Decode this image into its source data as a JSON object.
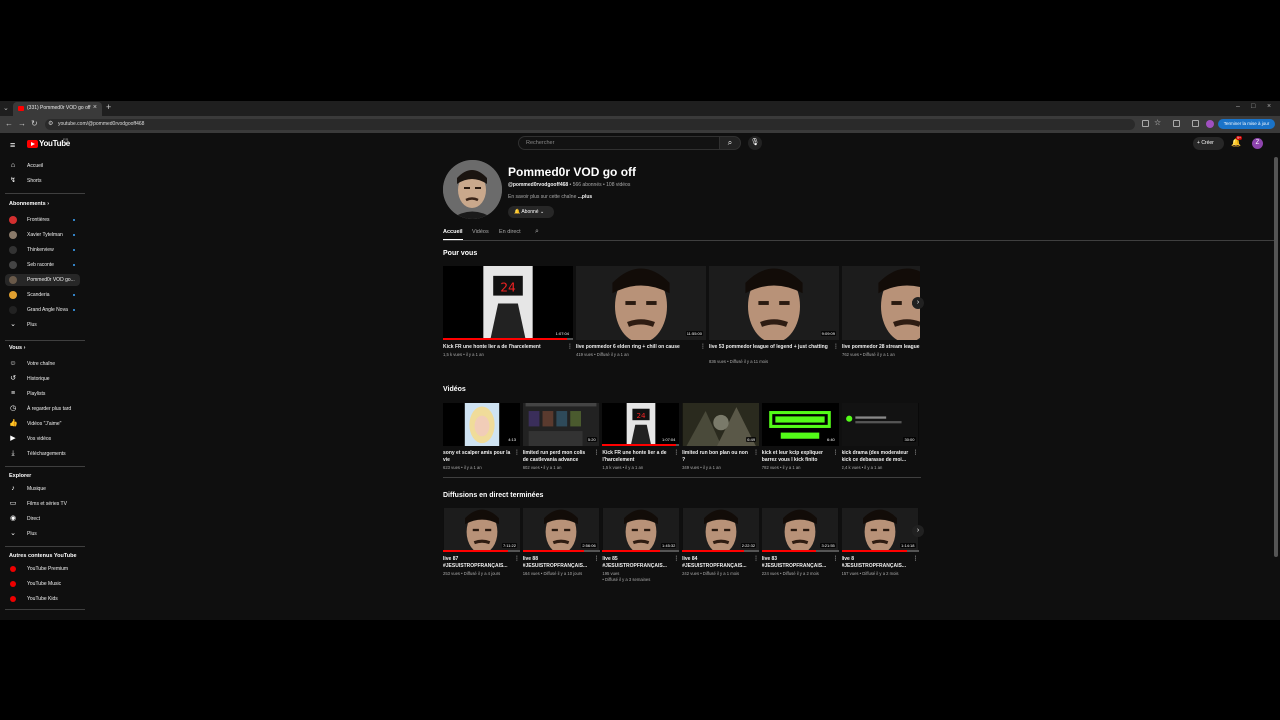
{
  "browser": {
    "tab_title": "(331) Pommed0r VOD go off",
    "url": "youtube.com/@pommed0rvodgooff468",
    "update_label": "Terminer la mise à jour"
  },
  "header": {
    "logo_text": "YouTube",
    "region": "FR",
    "search_placeholder": "Rechercher",
    "create_label": "Créer",
    "notif_count": "9+",
    "avatar_letter": "Z"
  },
  "sidebar": {
    "main": [
      {
        "label": "Accueil",
        "icon": "home-icon",
        "glyph": "⌂"
      },
      {
        "label": "Shorts",
        "icon": "shorts-icon",
        "glyph": "↯"
      }
    ],
    "subscriptions_title": "Abonnements",
    "subscriptions": [
      {
        "label": "Frontières",
        "color": "#d32f2f",
        "active": false
      },
      {
        "label": "Xavier Tytelman",
        "color": "#8a7a6a",
        "active": false
      },
      {
        "label": "Thinkerview",
        "color": "#333333",
        "active": false
      },
      {
        "label": "Seb raconte",
        "color": "#444444",
        "active": false
      },
      {
        "label": "Pommed0r VOD go...",
        "color": "#6a5a4a",
        "active": true
      },
      {
        "label": "Scanderia",
        "color": "#e0a030",
        "active": false
      },
      {
        "label": "Grand Angle Nova",
        "color": "#222222",
        "active": false
      },
      {
        "label": "Plus",
        "color": "",
        "active": false
      }
    ],
    "you_title": "Vous",
    "you": [
      {
        "label": "Votre chaîne",
        "icon": "channel-icon",
        "glyph": "☺"
      },
      {
        "label": "Historique",
        "icon": "history-icon",
        "glyph": "↺"
      },
      {
        "label": "Playlists",
        "icon": "playlist-icon",
        "glyph": "≡"
      },
      {
        "label": "À regarder plus tard",
        "icon": "clock-icon",
        "glyph": "◷"
      },
      {
        "label": "Vidéos \"J'aime\"",
        "icon": "like-icon",
        "glyph": "👍"
      },
      {
        "label": "Vos vidéos",
        "icon": "video-icon",
        "glyph": "▶"
      },
      {
        "label": "Téléchargements",
        "icon": "download-icon",
        "glyph": "⤓"
      }
    ],
    "explore_title": "Explorer",
    "explore": [
      {
        "label": "Musique",
        "icon": "music-icon",
        "glyph": "♪"
      },
      {
        "label": "Films et séries TV",
        "icon": "film-icon",
        "glyph": "▭"
      },
      {
        "label": "Direct",
        "icon": "live-icon",
        "glyph": "◉"
      },
      {
        "label": "Plus",
        "icon": "chevron-down-icon",
        "glyph": "⌄"
      }
    ],
    "more_title": "Autres contenus YouTube",
    "more": [
      {
        "label": "YouTube Premium",
        "icon": "yt-premium-icon"
      },
      {
        "label": "YouTube Music",
        "icon": "yt-music-icon"
      },
      {
        "label": "YouTube Kids",
        "icon": "yt-kids-icon"
      }
    ]
  },
  "channel": {
    "name": "Pommed0r VOD go off",
    "handle": "@pommed0rvodgooff468",
    "stats": " • 566 abonnés • 108 vidéos",
    "desc": "En savoir plus sur cette chaîne ",
    "desc_more": "...plus",
    "subscribe_label": "Abonné",
    "tabs": [
      "Accueil",
      "Vidéos",
      "En direct"
    ]
  },
  "for_you": {
    "title": "Pour vous",
    "items": [
      {
        "title": "Kick FR une honte lier a de l'harcelement",
        "meta": "1,5 k vues • il y a 1 an",
        "duration": "1:07:04",
        "thumb": "suit",
        "progress": 0.95
      },
      {
        "title": "live pommedor 6 elden ring + chill on cause",
        "meta": "419 vues • Diffusé il y a 1 an",
        "duration": "11:55:00",
        "thumb": "face",
        "progress": 0.0
      },
      {
        "title": "live 53 pommedor league of legend + just chatting",
        "meta": "836 vues • Diffusé il y a 11 mois",
        "duration": "9:09:09",
        "thumb": "face",
        "progress": 0.0
      },
      {
        "title": "live pommedor 28 stream league",
        "meta": "762 vues • Diffusé il y a 1 an",
        "duration": "",
        "thumb": "face",
        "progress": 0.0
      }
    ]
  },
  "videos": {
    "title": "Vidéos",
    "items": [
      {
        "title": "sony et scalper amis pour la vie",
        "meta": "623 vues • il y a 1 an",
        "duration": "4:13",
        "thumb": "blonde",
        "progress": 0.0
      },
      {
        "title": "limited run perd mon colis de castlevania advance collect...",
        "meta": "602 vues • il y a 1 an",
        "duration": "5:20",
        "thumb": "screen",
        "progress": 0.0
      },
      {
        "title": "Kick FR une honte lier a de l'harcelement",
        "meta": "1,5 k vues • il y a 1 an",
        "duration": "1:07:04",
        "thumb": "suit",
        "progress": 0.95
      },
      {
        "title": "limited run bon plan ou non ?",
        "meta": "349 vues • il y a 1 an",
        "duration": "6:49",
        "thumb": "doom",
        "progress": 0.0
      },
      {
        "title": "kick et leur kcip expliquer barrez vous I kick finito",
        "meta": "782 vues • il y a 1 an",
        "duration": "6:40",
        "thumb": "kick",
        "progress": 0.0
      },
      {
        "title": "kick drama (des moderateur kick ce debarasse de moi...",
        "meta": "2,4 k vues • il y a 1 an",
        "duration": "30:00",
        "thumb": "chat",
        "progress": 0.0
      }
    ]
  },
  "lives": {
    "title": "Diffusions en direct terminées",
    "items": [
      {
        "title": "live 87 #JESUISTROPFRANÇAIS...",
        "meta": "253 vues • Diffusé il y a 4 jours",
        "meta2": "",
        "duration": "7:11:22",
        "progress": 0.85
      },
      {
        "title": "live 88 #JESUISTROPFRANÇAIS...",
        "meta": "164 vues • Diffusé il y a 10 jours",
        "meta2": "",
        "duration": "2:56:06",
        "progress": 0.8
      },
      {
        "title": "live 85 #JESUISTROPFRANÇAIS...",
        "meta": "195 vues",
        "meta2": "• Diffusé il y a 3 semaines",
        "duration": "1:45:32",
        "progress": 0.75
      },
      {
        "title": "live 84 #JESUISTROPFRANÇAIS...",
        "meta": "242 vues • Diffusé il y a 1 mois",
        "meta2": "",
        "duration": "2:22:32",
        "progress": 0.8
      },
      {
        "title": "live 83 #JESUISTROPFRANÇAIS...",
        "meta": "224 vues • Diffusé il y a 2 mois",
        "meta2": "",
        "duration": "3:21:55",
        "progress": 0.7
      },
      {
        "title": "live 8 #JESUISTROPFRANÇAIS...",
        "meta": "157 vues • Diffusé il y a 2 mois",
        "meta2": "",
        "duration": "1:14:18",
        "progress": 0.85
      }
    ]
  }
}
